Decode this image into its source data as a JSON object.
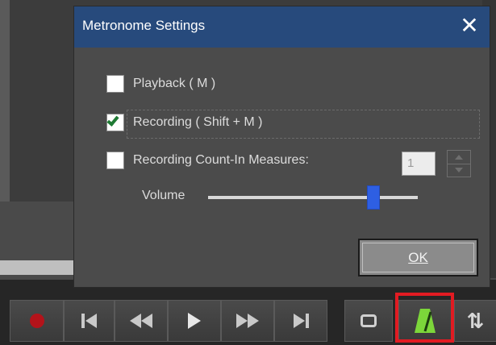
{
  "dialog": {
    "title": "Metronome Settings",
    "close_glyph": "✕",
    "playback_label": "Playback ( M )",
    "playback_checked": false,
    "recording_label": "Recording ( Shift + M )",
    "recording_checked": true,
    "countin_label": "Recording Count-In Measures:",
    "countin_checked": false,
    "countin_value": "1",
    "volume_label": "Volume",
    "volume_level": 0.79,
    "ok_label": "OK"
  },
  "transport": {
    "buttons": [
      "record-icon",
      "go-to-start-icon",
      "rewind-icon",
      "play-icon",
      "fast-forward-icon",
      "go-to-end-icon",
      "loop-icon",
      "metronome-icon",
      "sync-icon"
    ],
    "metronome_active_color": "#7cd63a",
    "highlight_color": "#e11b22"
  },
  "colors": {
    "titlebar": "#274a7c",
    "dialog_bg": "#4b4b4b",
    "slider_thumb": "#2e5fe3"
  }
}
